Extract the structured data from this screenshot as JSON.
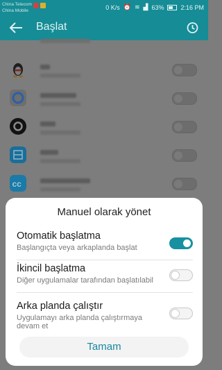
{
  "status_bar": {
    "carrier_1": "China Telecom",
    "carrier_2": "China Mobile",
    "speed": "0 K/s",
    "battery": "63%",
    "time": "2:16 PM"
  },
  "app_bar": {
    "title": "Başlat",
    "back_icon": "back-arrow",
    "history_icon": "history-clock"
  },
  "list": {
    "items": [
      {
        "icon": "qq-penguin",
        "icon_color": "#222222"
      },
      {
        "icon": "qq-browser",
        "icon_color": "#2a6fcf"
      },
      {
        "icon": "quik",
        "icon_color": "#111111"
      },
      {
        "icon": "scan",
        "icon_color": "#1e8fd8"
      },
      {
        "icon": "scan-business-card",
        "icon_color": "#1ba6e0"
      }
    ]
  },
  "dialog": {
    "title": "Manuel olarak yönet",
    "options": [
      {
        "title": "Otomatik başlatma",
        "desc": "Başlangıçta veya arkaplanda başlat",
        "enabled": true
      },
      {
        "title": "İkincil başlatma",
        "desc": "Diğer uygulamalar tarafından başlatılabil",
        "enabled": false
      },
      {
        "title": "Arka planda çalıştır",
        "desc": "Uygulamayı arka planda çalıştırmaya devam et",
        "enabled": false
      }
    ],
    "ok_label": "Tamam"
  },
  "colors": {
    "accent": "#158c96",
    "toggle_on": "#1790a2"
  }
}
